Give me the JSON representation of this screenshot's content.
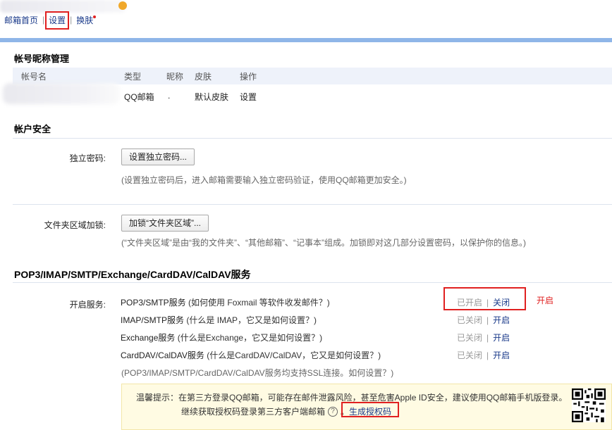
{
  "topbar": {
    "home_link": "邮箱首页",
    "settings_link": "设置",
    "skin_link": "换肤"
  },
  "account_section": {
    "title": "帐号昵称管理",
    "headers": [
      "帐号名",
      "类型",
      "昵称",
      "皮肤",
      "操作"
    ],
    "row": {
      "type": "QQ邮箱",
      "nickname": ".",
      "skin": "默认皮肤",
      "action": "设置"
    }
  },
  "security_section": {
    "title": "帐户安全",
    "independent_password": {
      "label": "独立密码:",
      "button": "设置独立密码...",
      "note": "(设置独立密码后，进入邮箱需要输入独立密码验证，使用QQ邮箱更加安全。)"
    },
    "folder_lock": {
      "label": "文件夹区域加锁:",
      "button": "加锁“文件夹区域”...",
      "note": "(“文件夹区域”是由“我的文件夹”、“其他邮箱”、“记事本”组成。加锁即对这几部分设置密码，以保护你的信息。)"
    }
  },
  "services_section": {
    "title": "POP3/IMAP/SMTP/Exchange/CardDAV/CalDAV服务",
    "label": "开启服务:",
    "services": [
      {
        "name": "POP3/SMTP服务",
        "help": "(如何使用 Foxmail 等软件收发邮件？)",
        "status": "已开启",
        "action": "关闭"
      },
      {
        "name": "IMAP/SMTP服务",
        "help": "(什么是 IMAP，它又是如何设置？)",
        "status": "已关闭",
        "action": "开启"
      },
      {
        "name": "Exchange服务",
        "help": "(什么是Exchange，它又是如何设置？)",
        "status": "已关闭",
        "action": "开启"
      },
      {
        "name": "CardDAV/CalDAV服务",
        "help": "(什么是CardDAV/CalDAV，它又是如何设置？)",
        "status": "已关闭",
        "action": "开启"
      }
    ],
    "ssl_note": "(POP3/IMAP/SMTP/CardDAV/CalDAV服务均支持SSL连接。如何设置？)",
    "annotation": "开启"
  },
  "tip": {
    "line1": "温馨提示：在第三方登录QQ邮箱，可能存在邮件泄露风险，甚至危害Apple ID安全，建议使用QQ邮箱手机版登录。",
    "line2": "继续获取授权码登录第三方客户端邮箱",
    "help_glyph": "?",
    "end_punct": "。",
    "generate_link": "生成授权码"
  },
  "colors": {
    "accent_bar": "#8fb6e8",
    "header_bg": "#eef2fa",
    "highlight_red": "#e02020",
    "tip_bg": "#fffbe3",
    "link": "#1a3a8a"
  }
}
